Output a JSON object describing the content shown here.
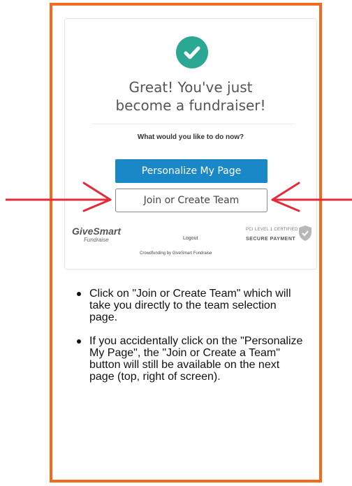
{
  "headline": {
    "line1": "Great! You've just",
    "line2": "become a fundraiser!"
  },
  "question": "What would you like to do now?",
  "buttons": {
    "personalize": "Personalize My Page",
    "join_team": "Join or Create Team"
  },
  "footer": {
    "logo": "GiveSmart",
    "logo_sub": "Fundraise",
    "logout": "Logout",
    "crowdfunding": "Crowdfunding by GiveSmart Fundraise",
    "pci": "PCI LEVEL 1 CERTIFIED",
    "secure": "SECURE PAYMENT"
  },
  "instructions": [
    "Click on \"Join or Create Team\" which will take you directly to the team selection page.",
    "If you accidentally click on the \"Personalize My Page\",  the \"Join or Create a Team\"  button will still be available on the next page (top, right of screen)."
  ],
  "colors": {
    "frame": "#f26b1d",
    "primary_button": "#1a87c7",
    "check": "#2aa893",
    "arrow": "#e32b3c"
  },
  "icons": {
    "check": "check-circle-icon",
    "shield": "shield-check-icon",
    "arrow_left": "arrow-right-pointer",
    "arrow_right": "arrow-left-pointer"
  }
}
